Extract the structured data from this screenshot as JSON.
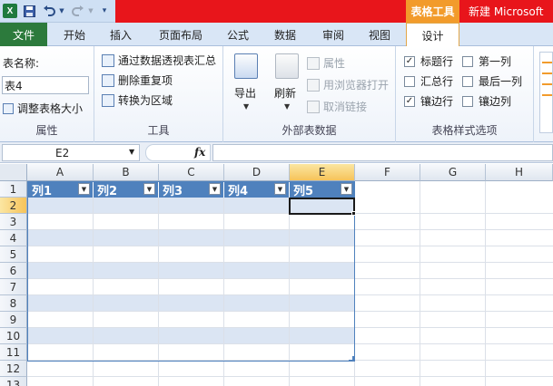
{
  "titlebar": {
    "app_icon": "excel-icon",
    "context_tab": "表格工具",
    "window_title": "新建 Microsoft"
  },
  "tabs": [
    {
      "label": "文件"
    },
    {
      "label": "开始"
    },
    {
      "label": "插入"
    },
    {
      "label": "页面布局"
    },
    {
      "label": "公式"
    },
    {
      "label": "数据"
    },
    {
      "label": "审阅"
    },
    {
      "label": "视图"
    },
    {
      "label": "设计"
    }
  ],
  "ribbon": {
    "properties": {
      "table_name_label": "表名称:",
      "table_name_value": "表4",
      "resize_label": "调整表格大小",
      "group_label": "属性"
    },
    "tools": {
      "pivot_label": "通过数据透视表汇总",
      "remove_dup_label": "删除重复项",
      "convert_label": "转换为区域",
      "group_label": "工具"
    },
    "external": {
      "export_label": "导出",
      "refresh_label": "刷新",
      "properties_label": "属性",
      "browser_label": "用浏览器打开",
      "unlink_label": "取消链接",
      "group_label": "外部表数据"
    },
    "style_options": {
      "header_row": "标题行",
      "total_row": "汇总行",
      "banded_rows": "镶边行",
      "first_column": "第一列",
      "last_column": "最后一列",
      "banded_columns": "镶边列",
      "group_label": "表格样式选项"
    }
  },
  "formula_bar": {
    "name_box": "E2",
    "fx": "fx"
  },
  "grid": {
    "columns": [
      "A",
      "B",
      "C",
      "D",
      "E",
      "F",
      "G",
      "H"
    ],
    "rows": [
      "1",
      "2",
      "3",
      "4",
      "5",
      "6",
      "7",
      "8",
      "9",
      "10",
      "11",
      "12",
      "13"
    ],
    "table_headers": [
      "列1",
      "列2",
      "列3",
      "列4",
      "列5"
    ],
    "selected_cell": "E2"
  },
  "colors": {
    "table_header": "#4f81bd",
    "band": "#dbe5f3",
    "title_red": "#e8151b",
    "context_orange": "#f29b2b",
    "file_tab": "#2c7a3c"
  }
}
